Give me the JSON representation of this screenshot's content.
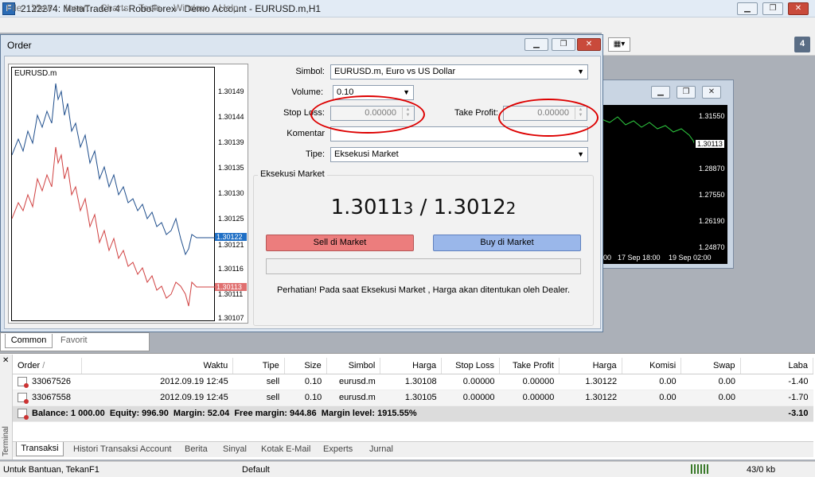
{
  "window": {
    "title": "2122274: MetaTrader 4 - RoboForex - Demo Account - EURUSD.m,H1",
    "icon": "metatrader-icon"
  },
  "menu": [
    "File",
    "View",
    "Insert",
    "Charts",
    "Tools",
    "Window",
    "Help"
  ],
  "order": {
    "title": "Order",
    "chart_symbol": "EURUSD.m",
    "price_ticks": [
      "1.30149",
      "1.30144",
      "1.30139",
      "1.30135",
      "1.30130",
      "1.30125",
      "1.30121",
      "1.30116",
      "1.30111",
      "1.30107"
    ],
    "ask_marker": "1.30122",
    "bid_marker": "1.30113",
    "fields": {
      "symbol_label": "Simbol:",
      "symbol_value": "EURUSD.m, Euro vs US Dollar",
      "volume_label": "Volume:",
      "volume_value": "0.10",
      "sl_label": "Stop Loss:",
      "sl_value": "0.00000",
      "tp_label": "Take Profit:",
      "tp_value": "0.00000",
      "comment_label": "Komentar",
      "comment_value": "",
      "type_label": "Tipe:",
      "type_value": "Eksekusi Market"
    },
    "exec_title": "Eksekusi Market",
    "bid_main": "1.3011",
    "bid_last": "3",
    "sep": " / ",
    "ask_main": "1.3012",
    "ask_last": "2",
    "sell_label": "Sell di Market",
    "buy_label": "Buy di Market",
    "note": "Perhatian! Pada saat Eksekusi Market , Harga akan ditentukan oleh Dealer.",
    "colors": {
      "sell": "#ec7d7d",
      "buy": "#9ab7ea",
      "ask_line": "#1f4e8c",
      "bid_line": "#d04040"
    }
  },
  "bgchart": {
    "ticks": [
      "1.31550",
      "1.30113",
      "1.28870",
      "1.27550",
      "1.26190",
      "1.24870"
    ],
    "times": [
      "00",
      "17 Sep 18:00",
      "19 Sep 02:00"
    ]
  },
  "nav_tabs": [
    "Common",
    "Favorit"
  ],
  "terminal": {
    "label": "Terminal",
    "columns": [
      "Order",
      "Waktu",
      "Tipe",
      "Size",
      "Simbol",
      "Harga",
      "Stop Loss",
      "Take Profit",
      "Harga",
      "Komisi",
      "Swap",
      "Laba"
    ],
    "rows": [
      [
        "33067526",
        "2012.09.19 12:45",
        "sell",
        "0.10",
        "eurusd.m",
        "1.30108",
        "0.00000",
        "0.00000",
        "1.30122",
        "0.00",
        "0.00",
        "-1.40"
      ],
      [
        "33067558",
        "2012.09.19 12:45",
        "sell",
        "0.10",
        "eurusd.m",
        "1.30105",
        "0.00000",
        "0.00000",
        "1.30122",
        "0.00",
        "0.00",
        "-1.70"
      ]
    ],
    "summary": "Balance: 1 000.00  Equity: 996.90  Margin: 52.04  Free margin: 944.86  Margin level: 1915.55%",
    "summary_total": "-3.10",
    "tabs": [
      "Transaksi",
      "Histori Transaksi Account",
      "Berita",
      "Sinyal",
      "Kotak E-Mail",
      "Experts",
      "Jurnal"
    ]
  },
  "status": {
    "help": "Untuk Bantuan, TekanF1",
    "profile": "Default",
    "traffic": "43/0 kb"
  }
}
